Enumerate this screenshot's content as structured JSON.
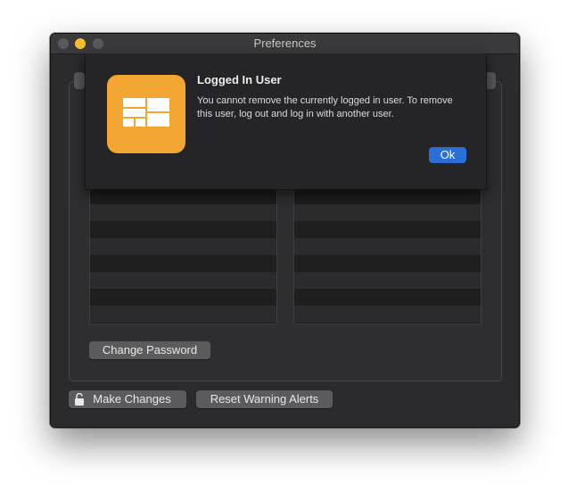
{
  "window": {
    "title": "Preferences"
  },
  "buttons": {
    "change_password": "Change Password",
    "make_changes": "Make Changes",
    "reset_warning_alerts": "Reset Warning Alerts"
  },
  "alert": {
    "title": "Logged In User",
    "message": "You cannot remove the currently logged in user. To remove this user, log out and log in with another user.",
    "ok_label": "Ok"
  },
  "icons": {
    "app": "app-grid-icon",
    "lock": "lock-open-icon"
  },
  "colors": {
    "accent": "#2a6ed8",
    "app_icon": "#f3a631",
    "minimize": "#f5bd30"
  }
}
